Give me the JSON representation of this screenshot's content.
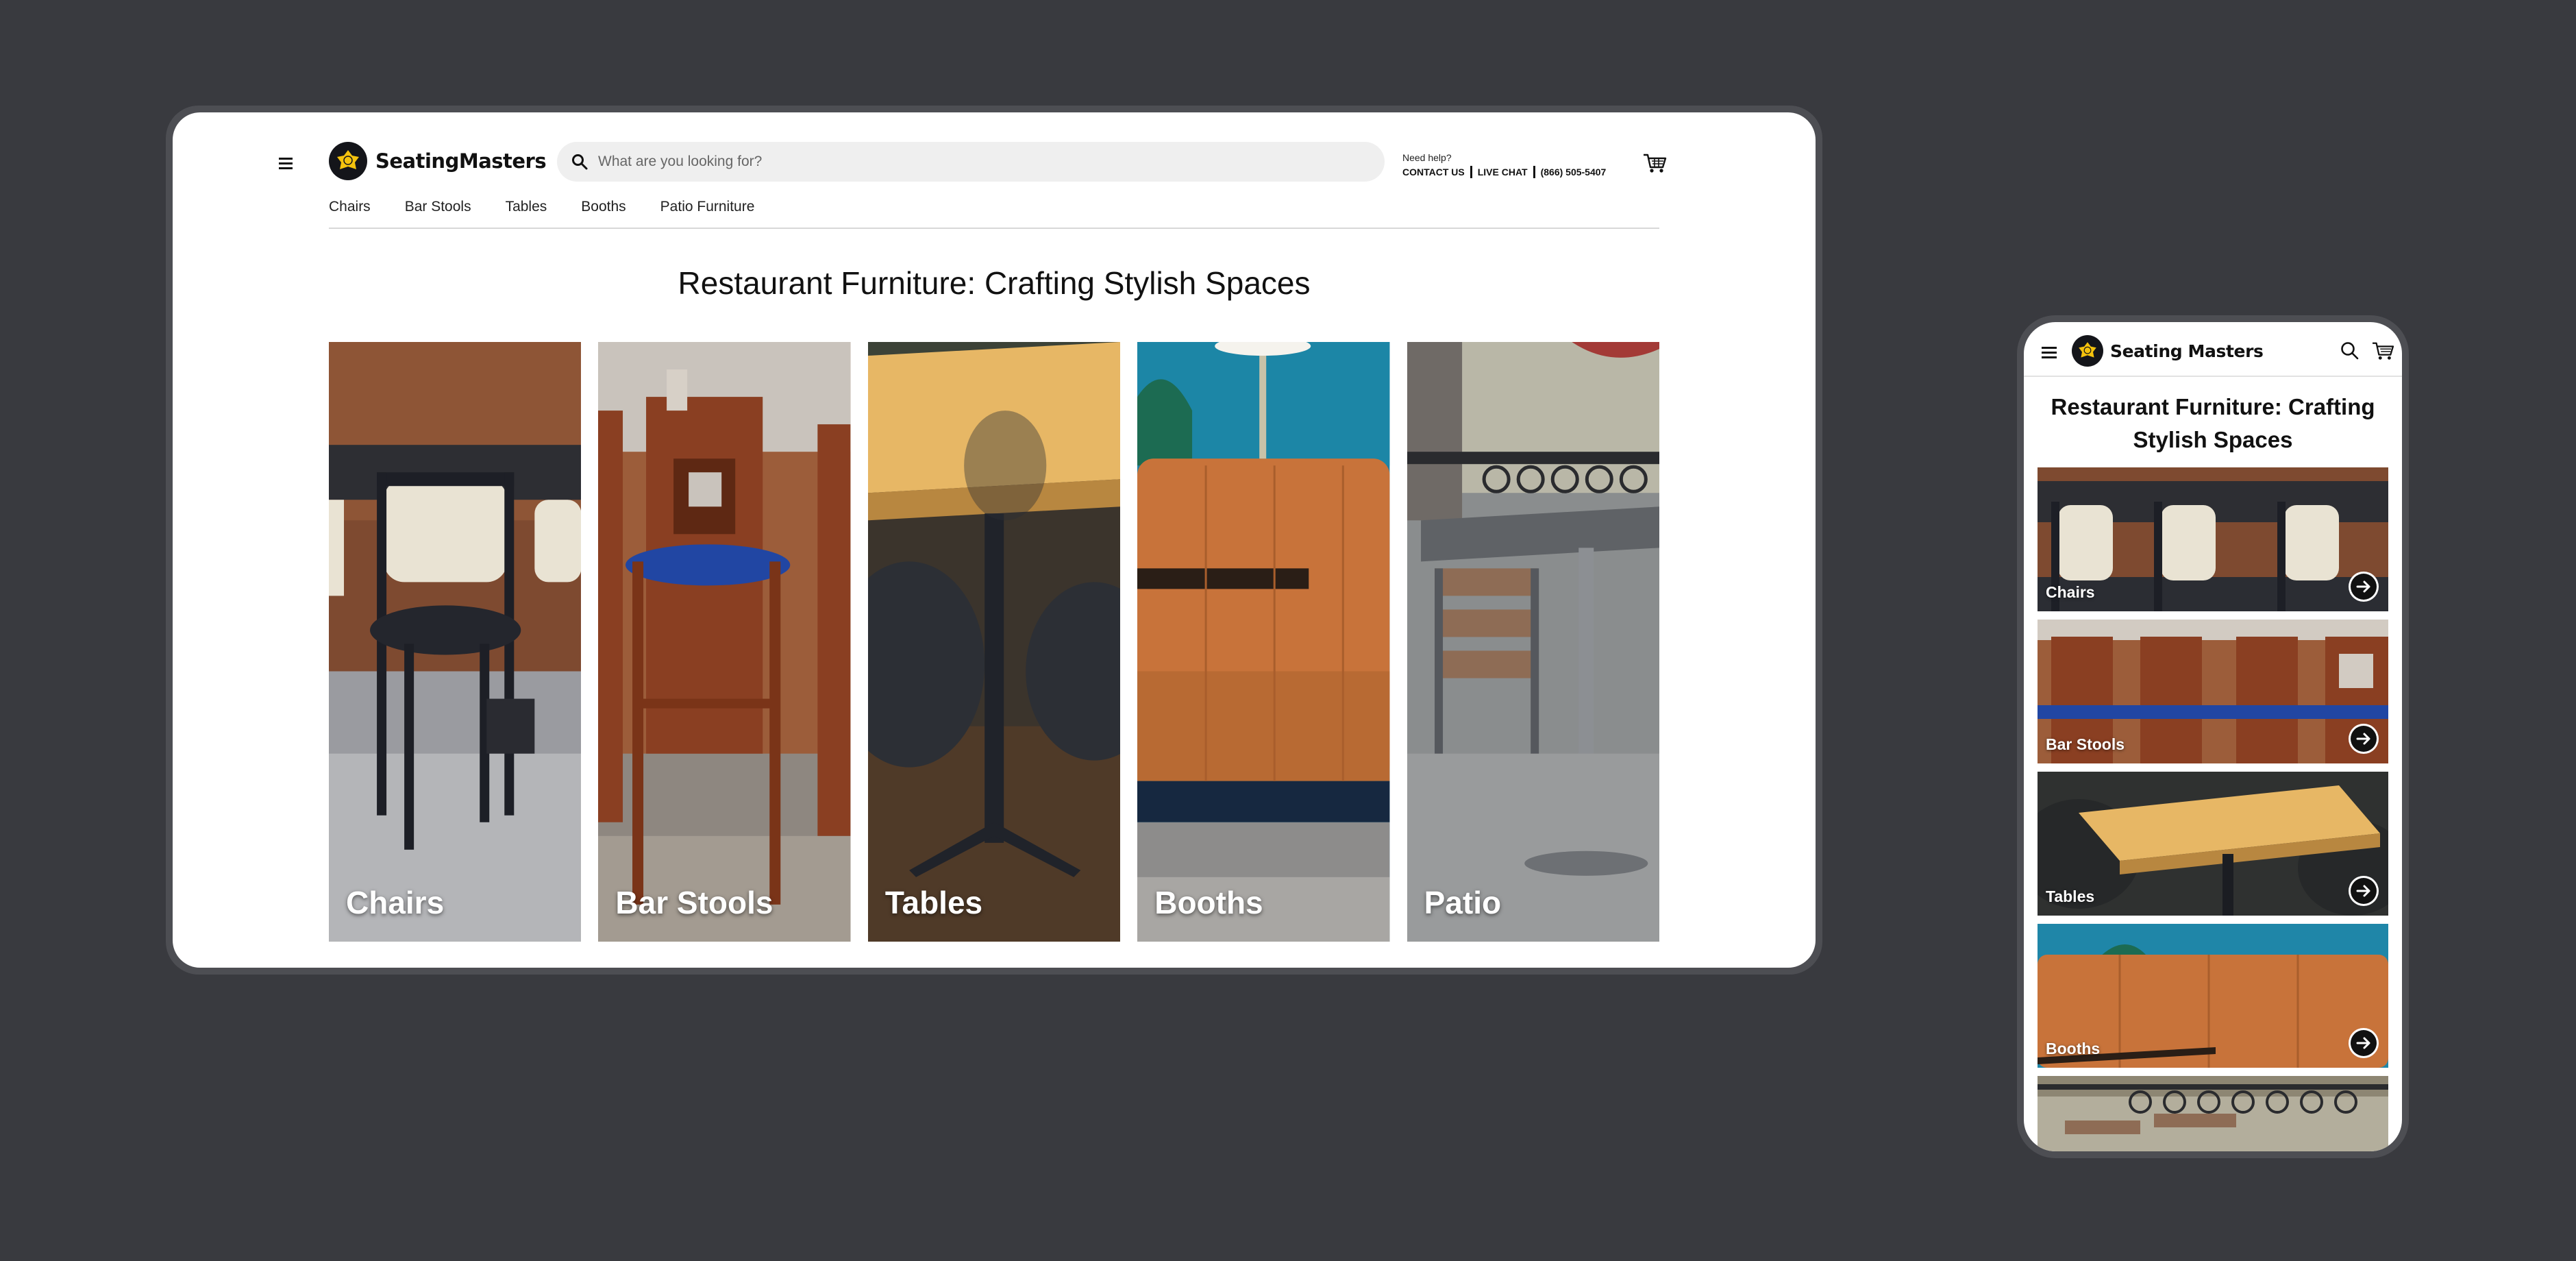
{
  "brand": {
    "name": "SeatingMasters",
    "name_mobile": "Seating Masters",
    "logo_color": "#f4c20d"
  },
  "desktop": {
    "search": {
      "placeholder": "What are you looking for?"
    },
    "help": {
      "label": "Need help?",
      "contact": "CONTACT US",
      "chat": "LIVE CHAT",
      "phone": "(866) 505-5407"
    },
    "nav": [
      "Chairs",
      "Bar Stools",
      "Tables",
      "Booths",
      "Patio Furniture"
    ],
    "title": "Restaurant Furniture: Crafting Stylish Spaces",
    "tiles": [
      "Chairs",
      "Bar Stools",
      "Tables",
      "Booths",
      "Patio"
    ]
  },
  "mobile": {
    "title": "Restaurant Furniture: Crafting Stylish Spaces",
    "tiles": [
      "Chairs",
      "Bar Stools",
      "Tables",
      "Booths"
    ]
  },
  "icons": {
    "menu": "hamburger-icon",
    "search": "search-icon",
    "cart": "cart-icon",
    "arrow": "arrow-right-icon"
  }
}
